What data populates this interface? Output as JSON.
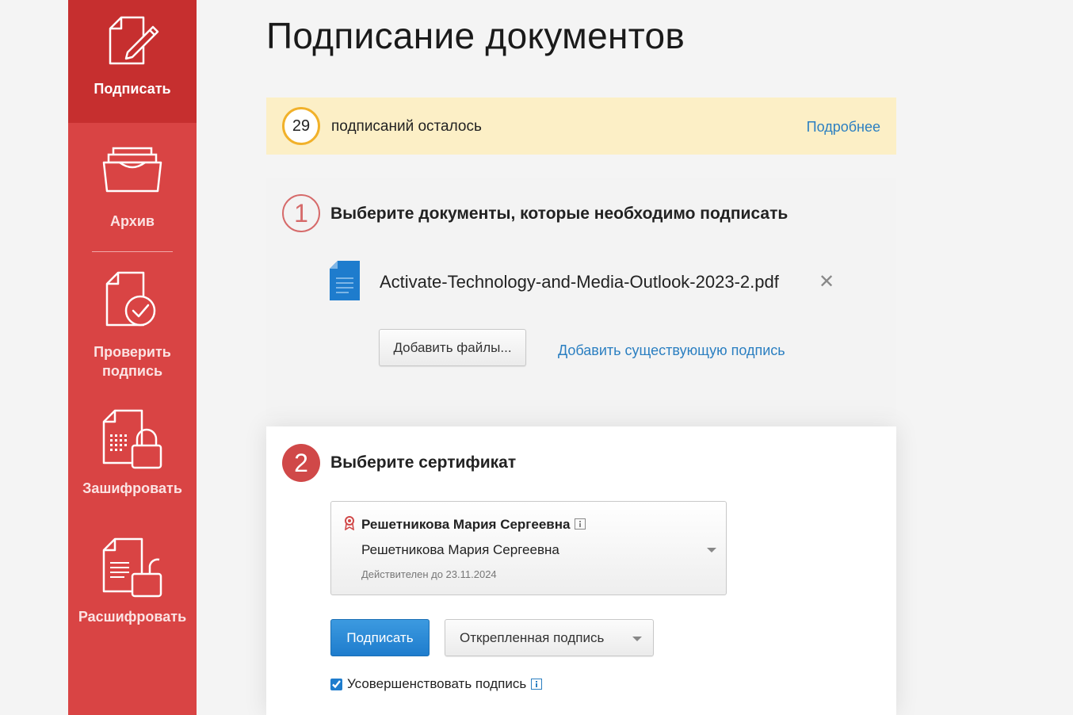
{
  "sidebar": {
    "items": [
      {
        "label": "Подписать",
        "icon": "sign-document-icon",
        "active": true
      },
      {
        "label": "Архив",
        "icon": "archive-tray-icon",
        "active": false
      },
      {
        "label": "Проверить подпись",
        "icon": "verify-signature-icon",
        "active": false
      },
      {
        "label": "Зашифровать",
        "icon": "encrypt-document-icon",
        "active": false
      },
      {
        "label": "Расшифровать",
        "icon": "decrypt-document-icon",
        "active": false
      }
    ]
  },
  "page": {
    "title": "Подписание документов"
  },
  "quota": {
    "count": "29",
    "text": "подписаний осталось",
    "more_link": "Подробнее"
  },
  "step1": {
    "number": "1",
    "title": "Выберите документы, которые необходимо подписать",
    "file": {
      "name": "Activate-Technology-and-Media-Outlook-2023-2.pdf",
      "icon": "document-file-icon"
    },
    "add_files_label": "Добавить файлы...",
    "add_existing_label": "Добавить существующую подпись"
  },
  "step2": {
    "number": "2",
    "title": "Выберите сертификат",
    "certificate": {
      "name": "Решетникова Мария Сергеевна",
      "holder": "Решетникова Мария Сергеевна",
      "valid_until": "Действителен до 23.11.2024"
    },
    "sign_button": "Подписать",
    "signature_type": "Открепленная подпись",
    "improve_label": "Усовершенствовать подпись",
    "improve_checked": true
  },
  "colors": {
    "sidebar": "#d94444",
    "sidebar_active": "#c62f2f",
    "quota_bg": "#fcefc6",
    "quota_ring": "#f1b12a",
    "link": "#2b7fc1",
    "primary": "#1e7ccd"
  }
}
